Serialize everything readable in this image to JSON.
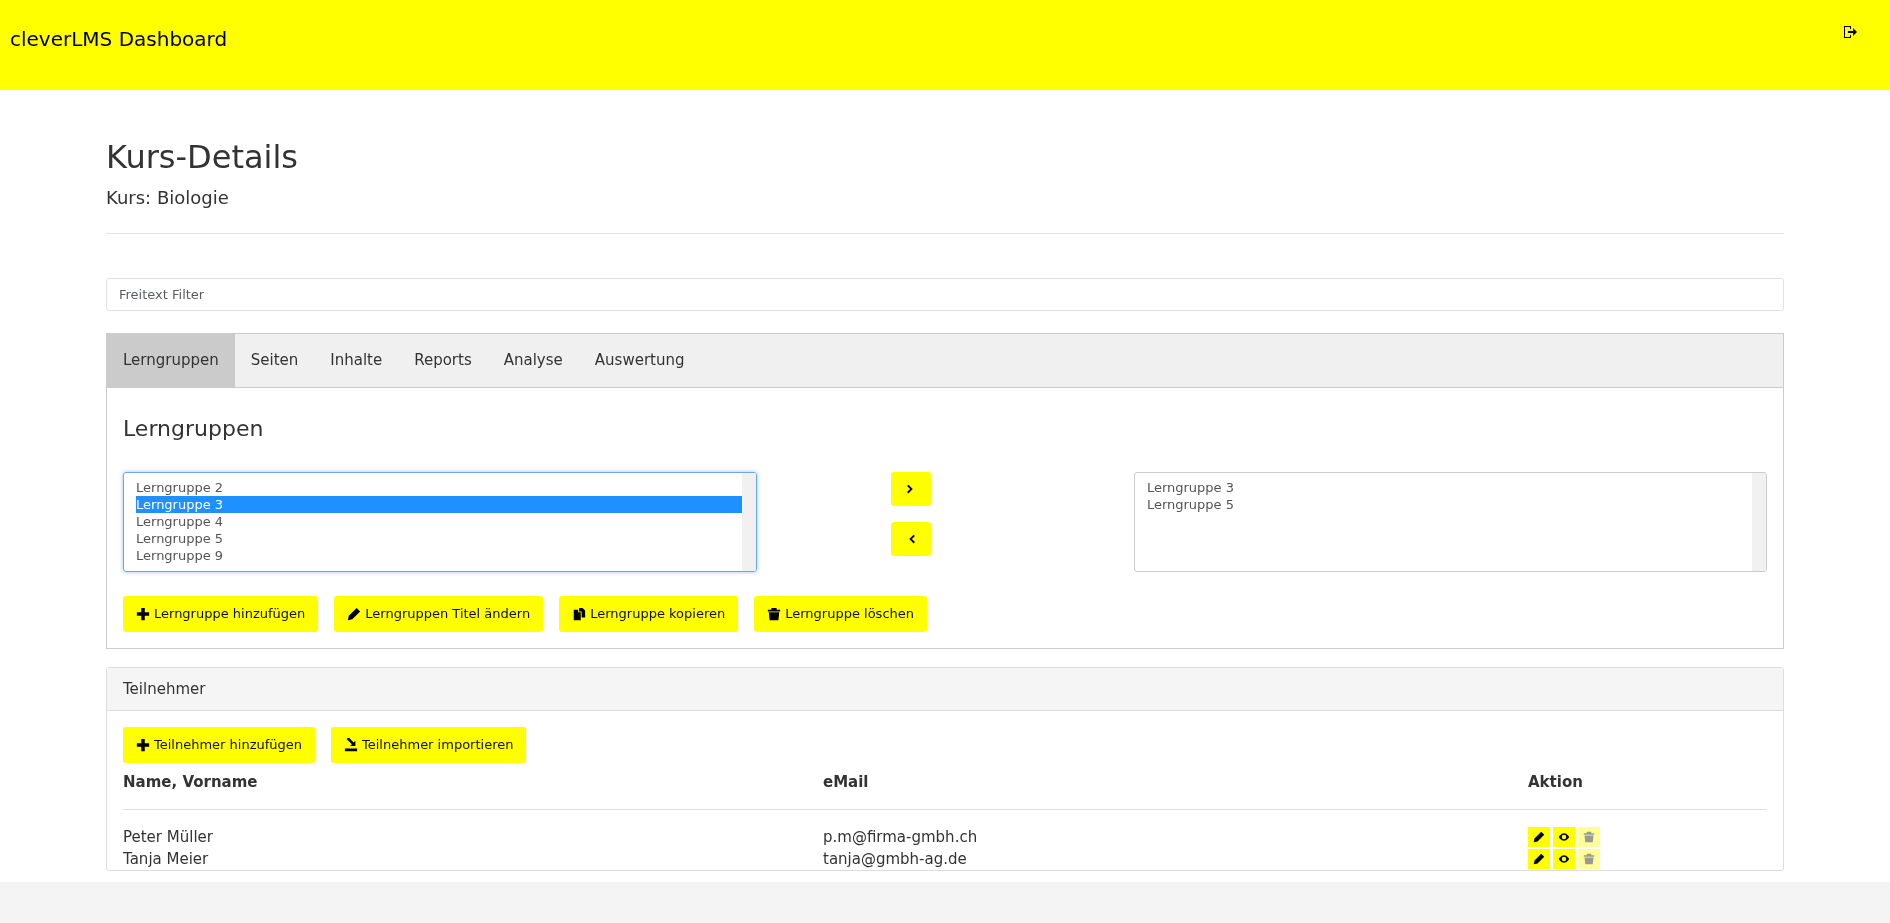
{
  "navbar": {
    "brand": "cleverLMS Dashboard"
  },
  "page": {
    "title": "Kurs-Details",
    "subtitle": "Kurs: Biologie"
  },
  "filter": {
    "placeholder": "Freitext Filter"
  },
  "tabs": [
    {
      "label": "Lerngruppen",
      "selected": true
    },
    {
      "label": "Seiten",
      "selected": false
    },
    {
      "label": "Inhalte",
      "selected": false
    },
    {
      "label": "Reports",
      "selected": false
    },
    {
      "label": "Analyse",
      "selected": false
    },
    {
      "label": "Auswertung",
      "selected": false
    }
  ],
  "lerngruppen": {
    "heading": "Lerngruppen",
    "available": [
      {
        "label": "Lerngruppe 2",
        "selected": false
      },
      {
        "label": "Lerngruppe 3",
        "selected": true
      },
      {
        "label": "Lerngruppe 4",
        "selected": false
      },
      {
        "label": "Lerngruppe 5",
        "selected": false
      },
      {
        "label": "Lerngruppe 9",
        "selected": false
      }
    ],
    "assigned": [
      {
        "label": "Lerngruppe 3",
        "selected": false
      },
      {
        "label": "Lerngruppe 5",
        "selected": false
      }
    ],
    "buttons": [
      {
        "kind": "plus",
        "label": "Lerngruppe hinzufügen"
      },
      {
        "kind": "pencil",
        "label": "Lerngruppen Titel ändern"
      },
      {
        "kind": "copy",
        "label": "Lerngruppe kopieren"
      },
      {
        "kind": "trash",
        "label": "Lerngruppe löschen"
      }
    ]
  },
  "teilnehmer": {
    "header": "Teilnehmer",
    "buttons": [
      {
        "kind": "plus",
        "label": "Teilnehmer hinzufügen"
      },
      {
        "kind": "import",
        "label": "Teilnehmer importieren"
      }
    ],
    "columns": [
      "Name, Vorname",
      "eMail",
      "Aktion"
    ],
    "rows": [
      {
        "name": "Peter Müller",
        "email": "p.m@firma-gmbh.ch",
        "actions": [
          {
            "kind": "pencil",
            "disabled": false
          },
          {
            "kind": "eye",
            "disabled": false
          },
          {
            "kind": "trash",
            "disabled": true
          }
        ]
      },
      {
        "name": "Tanja Meier",
        "email": "tanja@gmbh-ag.de",
        "actions": [
          {
            "kind": "pencil",
            "disabled": false
          },
          {
            "kind": "eye",
            "disabled": false
          },
          {
            "kind": "trash",
            "disabled": true
          }
        ]
      }
    ]
  }
}
